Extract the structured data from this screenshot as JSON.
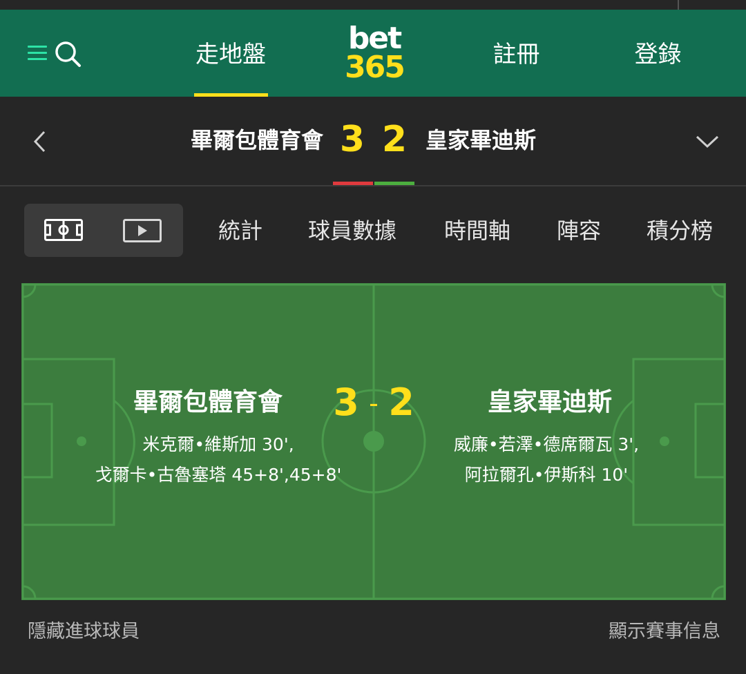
{
  "header": {
    "logo_top": "bet",
    "logo_bottom": "365",
    "nav": {
      "live": "走地盤",
      "register": "註冊",
      "login": "登錄"
    },
    "icons": [
      "menu-icon",
      "search-icon"
    ]
  },
  "scoreboard": {
    "home_team": "畢爾包體育會",
    "away_team": "皇家畢迪斯",
    "home_score": "3",
    "away_score": "2"
  },
  "tabs": {
    "views": [
      "pitch-view-icon",
      "video-icon"
    ],
    "stats": "統計",
    "player_data": "球員數據",
    "timeline": "時間軸",
    "lineup": "陣容",
    "table": "積分榜"
  },
  "pitch": {
    "home_team": "畢爾包體育會",
    "away_team": "皇家畢迪斯",
    "home_score": "3",
    "separator": "-",
    "away_score": "2",
    "home_scorers": [
      "米克爾•維斯加 30',",
      "戈爾卡•古魯塞塔 45+8',45+8'"
    ],
    "away_scorers": [
      "威廉•若澤•德席爾瓦 3',",
      "阿拉爾孔•伊斯科 10'"
    ]
  },
  "footer": {
    "hide_scorers": "隱藏進球球員",
    "show_match_info": "顯示賽事信息"
  },
  "colors": {
    "header_green": "#126e51",
    "accent_yellow": "#ffdf1b",
    "menu_mint": "#2de3a6",
    "pitch_green": "#3c7d3e",
    "home_bar": "#e03a3e",
    "away_bar": "#4cae3f",
    "background": "#262626"
  }
}
